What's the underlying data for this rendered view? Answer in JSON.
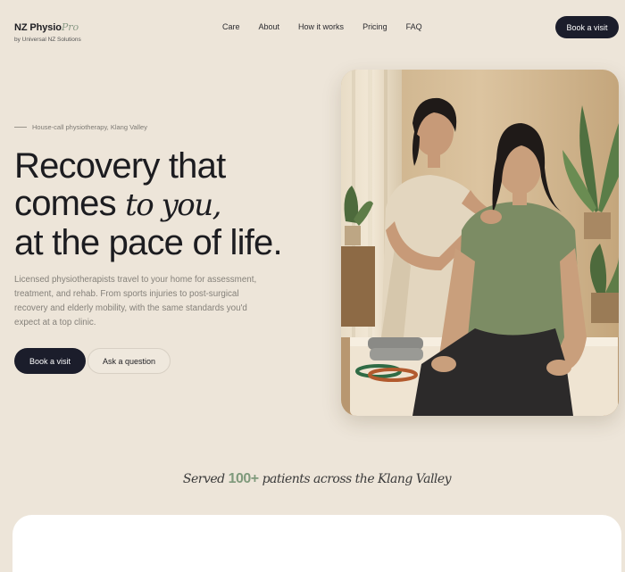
{
  "brand": {
    "name": "NZ Physio",
    "suffix": "Pro",
    "subtitle": "by Universal NZ Solutions"
  },
  "nav": {
    "items": [
      "Care",
      "About",
      "How it works",
      "Pricing",
      "FAQ"
    ]
  },
  "header": {
    "cta": "Book a visit"
  },
  "hero": {
    "eyebrow": "House-call physiotherapy, Klang Valley",
    "headline_line1": "Recovery that",
    "headline_line2_a": "comes ",
    "headline_line2_b": "to you,",
    "headline_line3": "at the pace of life.",
    "description": "Licensed physiotherapists travel to your home for assessment, treatment, and rehab. From sports injuries to post-surgical recovery and elderly mobility, with the same standards you'd expect at a top clinic.",
    "primary_cta": "Book a visit",
    "secondary_cta": "Ask a question"
  },
  "stats": {
    "prefix": "Served",
    "count": "100+",
    "suffix": "patients across the Klang Valley"
  },
  "colors": {
    "background": "#ede5d9",
    "dark": "#1b1d2b",
    "accent_green": "#7f9a7c"
  }
}
